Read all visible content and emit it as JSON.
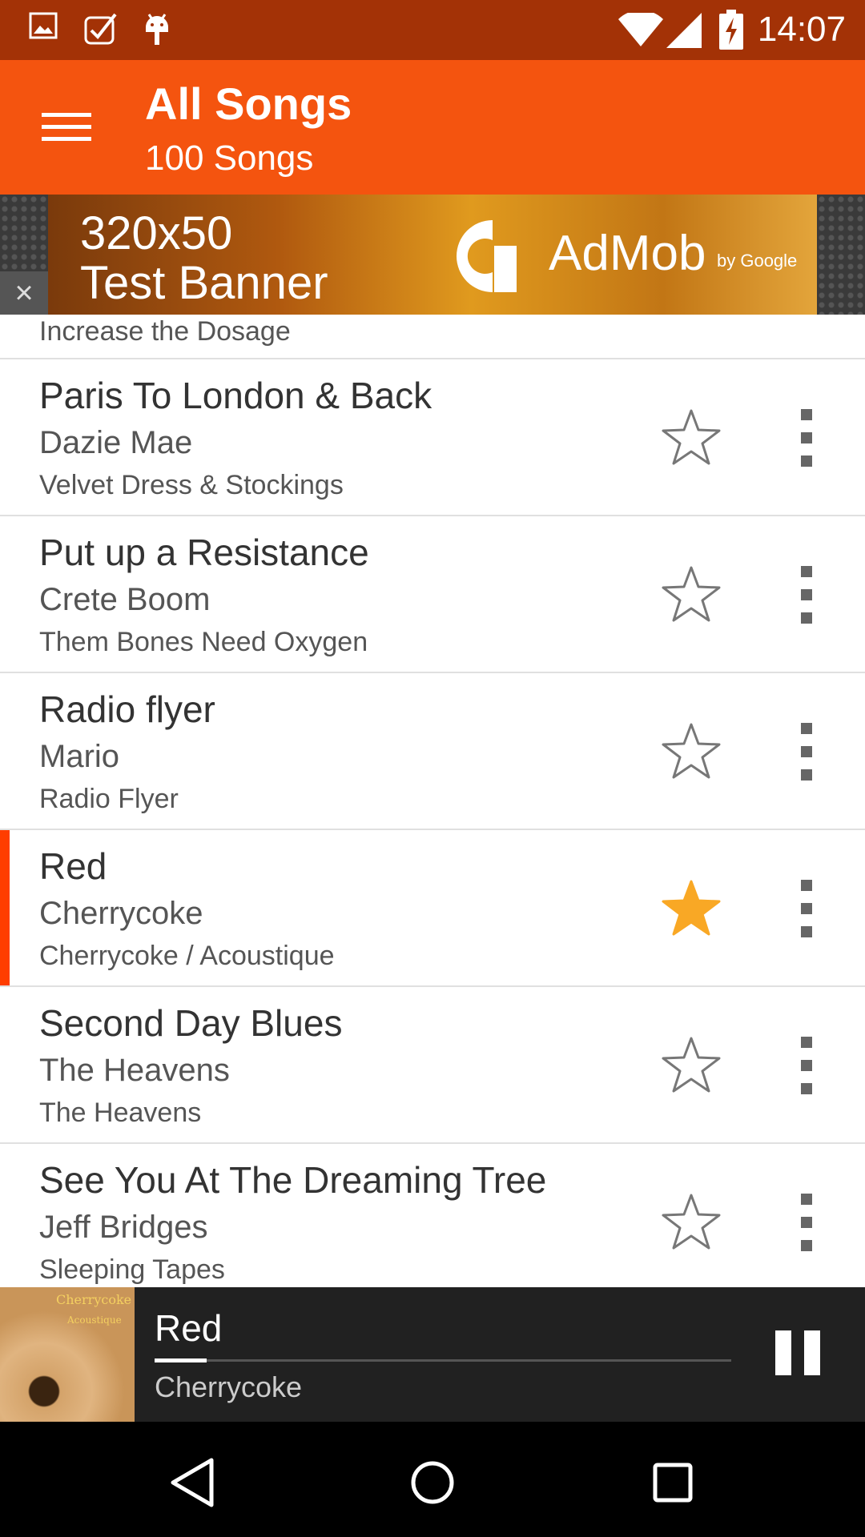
{
  "status_bar": {
    "time": "14:07",
    "left_icons": [
      "image-icon",
      "task-check-icon",
      "android-icon"
    ],
    "right_icons": [
      "wifi-icon",
      "signal-icon",
      "battery-charging-icon"
    ]
  },
  "app_bar": {
    "title": "All Songs",
    "subtitle": "100 Songs",
    "menu_icon": "hamburger-menu-icon",
    "color": "#f4540f"
  },
  "ad_banner": {
    "text_line1": "320x50",
    "text_line2": "Test Banner",
    "brand": "AdMob",
    "brand_by": "by Google",
    "close_label": "×"
  },
  "partial_row": {
    "album": "Increase the Dosage"
  },
  "songs": [
    {
      "title": "Paris To London & Back",
      "artist": "Dazie Mae",
      "album": "Velvet Dress & Stockings",
      "favorite": false,
      "playing": false
    },
    {
      "title": "Put up a Resistance",
      "artist": "Crete Boom",
      "album": "Them Bones Need Oxygen",
      "favorite": false,
      "playing": false
    },
    {
      "title": "Radio flyer",
      "artist": "Mario",
      "album": "Radio Flyer",
      "favorite": false,
      "playing": false
    },
    {
      "title": "Red",
      "artist": "Cherrycoke",
      "album": "Cherrycoke / Acoustique",
      "favorite": true,
      "playing": true
    },
    {
      "title": "Second Day Blues",
      "artist": "The Heavens",
      "album": "The Heavens",
      "favorite": false,
      "playing": false
    },
    {
      "title": "See You At The Dreaming Tree",
      "artist": "Jeff Bridges",
      "album": "Sleeping Tapes",
      "favorite": false,
      "playing": false
    }
  ],
  "now_playing": {
    "title": "Red",
    "artist": "Cherrycoke",
    "art_text1": "Cherrycoke",
    "art_text2": "Acoustique",
    "progress": 0.09
  },
  "colors": {
    "accent": "#f4540f",
    "status_bar": "#a33206",
    "favorite_star": "#f9a825",
    "playing_marker": "#ff3d00"
  }
}
